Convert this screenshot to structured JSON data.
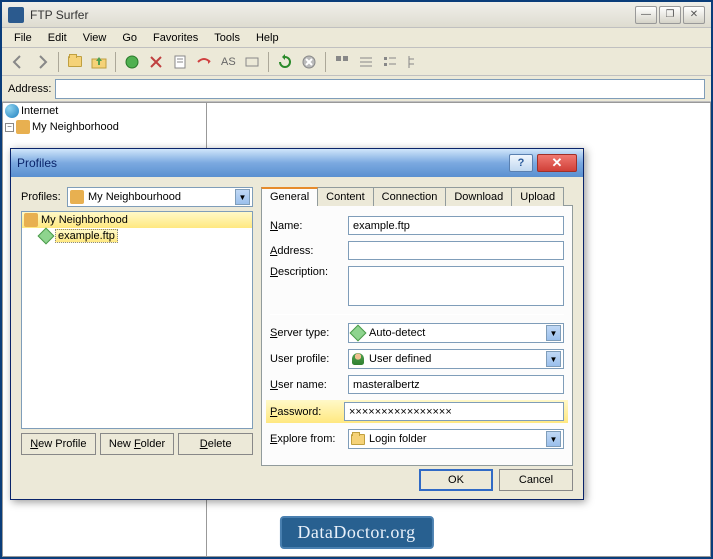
{
  "window": {
    "title": "FTP Surfer",
    "min": "—",
    "restore": "❐",
    "close": "✕"
  },
  "menu": {
    "file": "File",
    "edit": "Edit",
    "view": "View",
    "go": "Go",
    "favorites": "Favorites",
    "tools": "Tools",
    "help": "Help"
  },
  "addressbar": {
    "label": "Address:"
  },
  "tree": {
    "internet": "Internet",
    "neighborhood": "My Neighborhood"
  },
  "dialog": {
    "title": "Profiles",
    "help": "?",
    "close": "✕",
    "profiles_label": "Profiles:",
    "profiles_select": "My Neighbourhood",
    "tree_root": "My Neighborhood",
    "tree_child": "example.ftp",
    "btn_new_profile": "New Profile",
    "btn_new_folder": "New Folder",
    "btn_delete": "Delete",
    "tabs": {
      "general": "General",
      "content": "Content",
      "connection": "Connection",
      "download": "Download",
      "upload": "Upload"
    },
    "form": {
      "name_label": "Name:",
      "name_u": "N",
      "name_value": "example.ftp",
      "address_label": "Address:",
      "address_u": "A",
      "desc_label": "Description:",
      "desc_u": "D",
      "server_label": "Server type:",
      "server_u": "S",
      "server_value": "Auto-detect",
      "user_profile_label": "User profile:",
      "user_profile_value": "User defined",
      "username_label": "User name:",
      "username_u": "U",
      "username_value": "masteralbertz",
      "password_label": "Password:",
      "password_u": "P",
      "password_value": "××××××××××××××××",
      "explore_label": "Explore from:",
      "explore_u": "E",
      "explore_value": "Login folder"
    },
    "ok": "OK",
    "cancel": "Cancel"
  },
  "watermark": "DataDoctor.org"
}
